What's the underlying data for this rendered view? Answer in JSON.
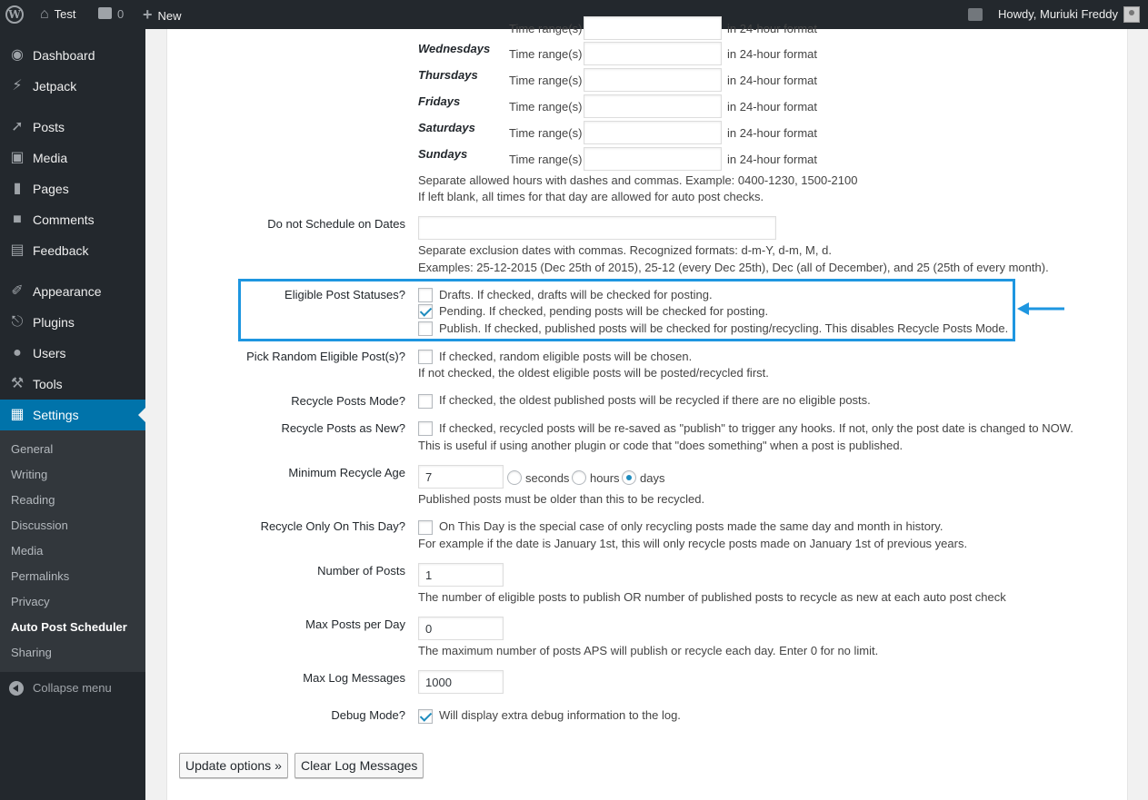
{
  "adminbar": {
    "site_name": "Test",
    "comments_count": "0",
    "new_label": "New",
    "greeting": "Howdy, Muriuki Freddy"
  },
  "sidebar": {
    "items": [
      {
        "label": "Dashboard",
        "icon": "dashboard-icon"
      },
      {
        "label": "Jetpack",
        "icon": "jetpack-icon"
      },
      {
        "label": "Posts",
        "icon": "pin-icon"
      },
      {
        "label": "Media",
        "icon": "media-icon"
      },
      {
        "label": "Pages",
        "icon": "pages-icon"
      },
      {
        "label": "Comments",
        "icon": "comment-icon"
      },
      {
        "label": "Feedback",
        "icon": "feedback-icon"
      },
      {
        "label": "Appearance",
        "icon": "brush-icon"
      },
      {
        "label": "Plugins",
        "icon": "plug-icon"
      },
      {
        "label": "Users",
        "icon": "user-icon"
      },
      {
        "label": "Tools",
        "icon": "wrench-icon"
      },
      {
        "label": "Settings",
        "icon": "settings-icon"
      }
    ],
    "submenu": [
      "General",
      "Writing",
      "Reading",
      "Discussion",
      "Media",
      "Permalinks",
      "Privacy",
      "Auto Post Scheduler",
      "Sharing"
    ],
    "collapse_label": "Collapse menu"
  },
  "schedule": {
    "time_range_label": "Time range(s)",
    "format_hint": "in 24-hour format",
    "days": [
      "Wednesdays",
      "Thursdays",
      "Fridays",
      "Saturdays",
      "Sundays"
    ],
    "hint1": "Separate allowed hours with dashes and commas. Example: 0400-1230, 1500-2100",
    "hint2": "If left blank, all times for that day are allowed for auto post checks."
  },
  "exclude_dates": {
    "label": "Do not Schedule on Dates",
    "value": "",
    "hint1": "Separate exclusion dates with commas. Recognized formats: d-m-Y, d-m, M, d.",
    "hint2": "Examples: 25-12-2015 (Dec 25th of 2015), 25-12 (every Dec 25th), Dec (all of December), and 25 (25th of every month)."
  },
  "eligible_statuses": {
    "label": "Eligible Post Statuses?",
    "drafts": "Drafts. If checked, drafts will be checked for posting.",
    "pending": "Pending. If checked, pending posts will be checked for posting.",
    "publish": "Publish. If checked, published posts will be checked for posting/recycling. This disables Recycle Posts Mode."
  },
  "random_posts": {
    "label": "Pick Random Eligible Post(s)?",
    "text": "If checked, random eligible posts will be chosen.",
    "hint": "If not checked, the oldest eligible posts will be posted/recycled first."
  },
  "recycle_mode": {
    "label": "Recycle Posts Mode?",
    "text": "If checked, the oldest published posts will be recycled if there are no eligible posts."
  },
  "recycle_as_new": {
    "label": "Recycle Posts as New?",
    "text": "If checked, recycled posts will be re-saved as \"publish\" to trigger any hooks. If not, only the post date is changed to NOW.",
    "hint": "This is useful if using another plugin or code that \"does something\" when a post is published."
  },
  "min_age": {
    "label": "Minimum Recycle Age",
    "value": "7",
    "unit_seconds": "seconds",
    "unit_hours": "hours",
    "unit_days": "days",
    "hint": "Published posts must be older than this to be recycled."
  },
  "this_day": {
    "label": "Recycle Only On This Day?",
    "text": "On This Day is the special case of only recycling posts made the same day and month in history.",
    "hint": "For example if the date is January 1st, this will only recycle posts made on January 1st of previous years."
  },
  "num_posts": {
    "label": "Number of Posts",
    "value": "1",
    "hint": "The number of eligible posts to publish OR number of published posts to recycle as new at each auto post check"
  },
  "max_posts": {
    "label": "Max Posts per Day",
    "value": "0",
    "hint": "The maximum number of posts APS will publish or recycle each day. Enter 0 for no limit."
  },
  "max_log": {
    "label": "Max Log Messages",
    "value": "1000"
  },
  "debug": {
    "label": "Debug Mode?",
    "text": "Will display extra debug information to the log."
  },
  "buttons": {
    "update": "Update options »",
    "clear_log": "Clear Log Messages"
  },
  "colors": {
    "highlight": "#1e96e0",
    "sidebar": "#23282d",
    "current": "#0073aa"
  }
}
